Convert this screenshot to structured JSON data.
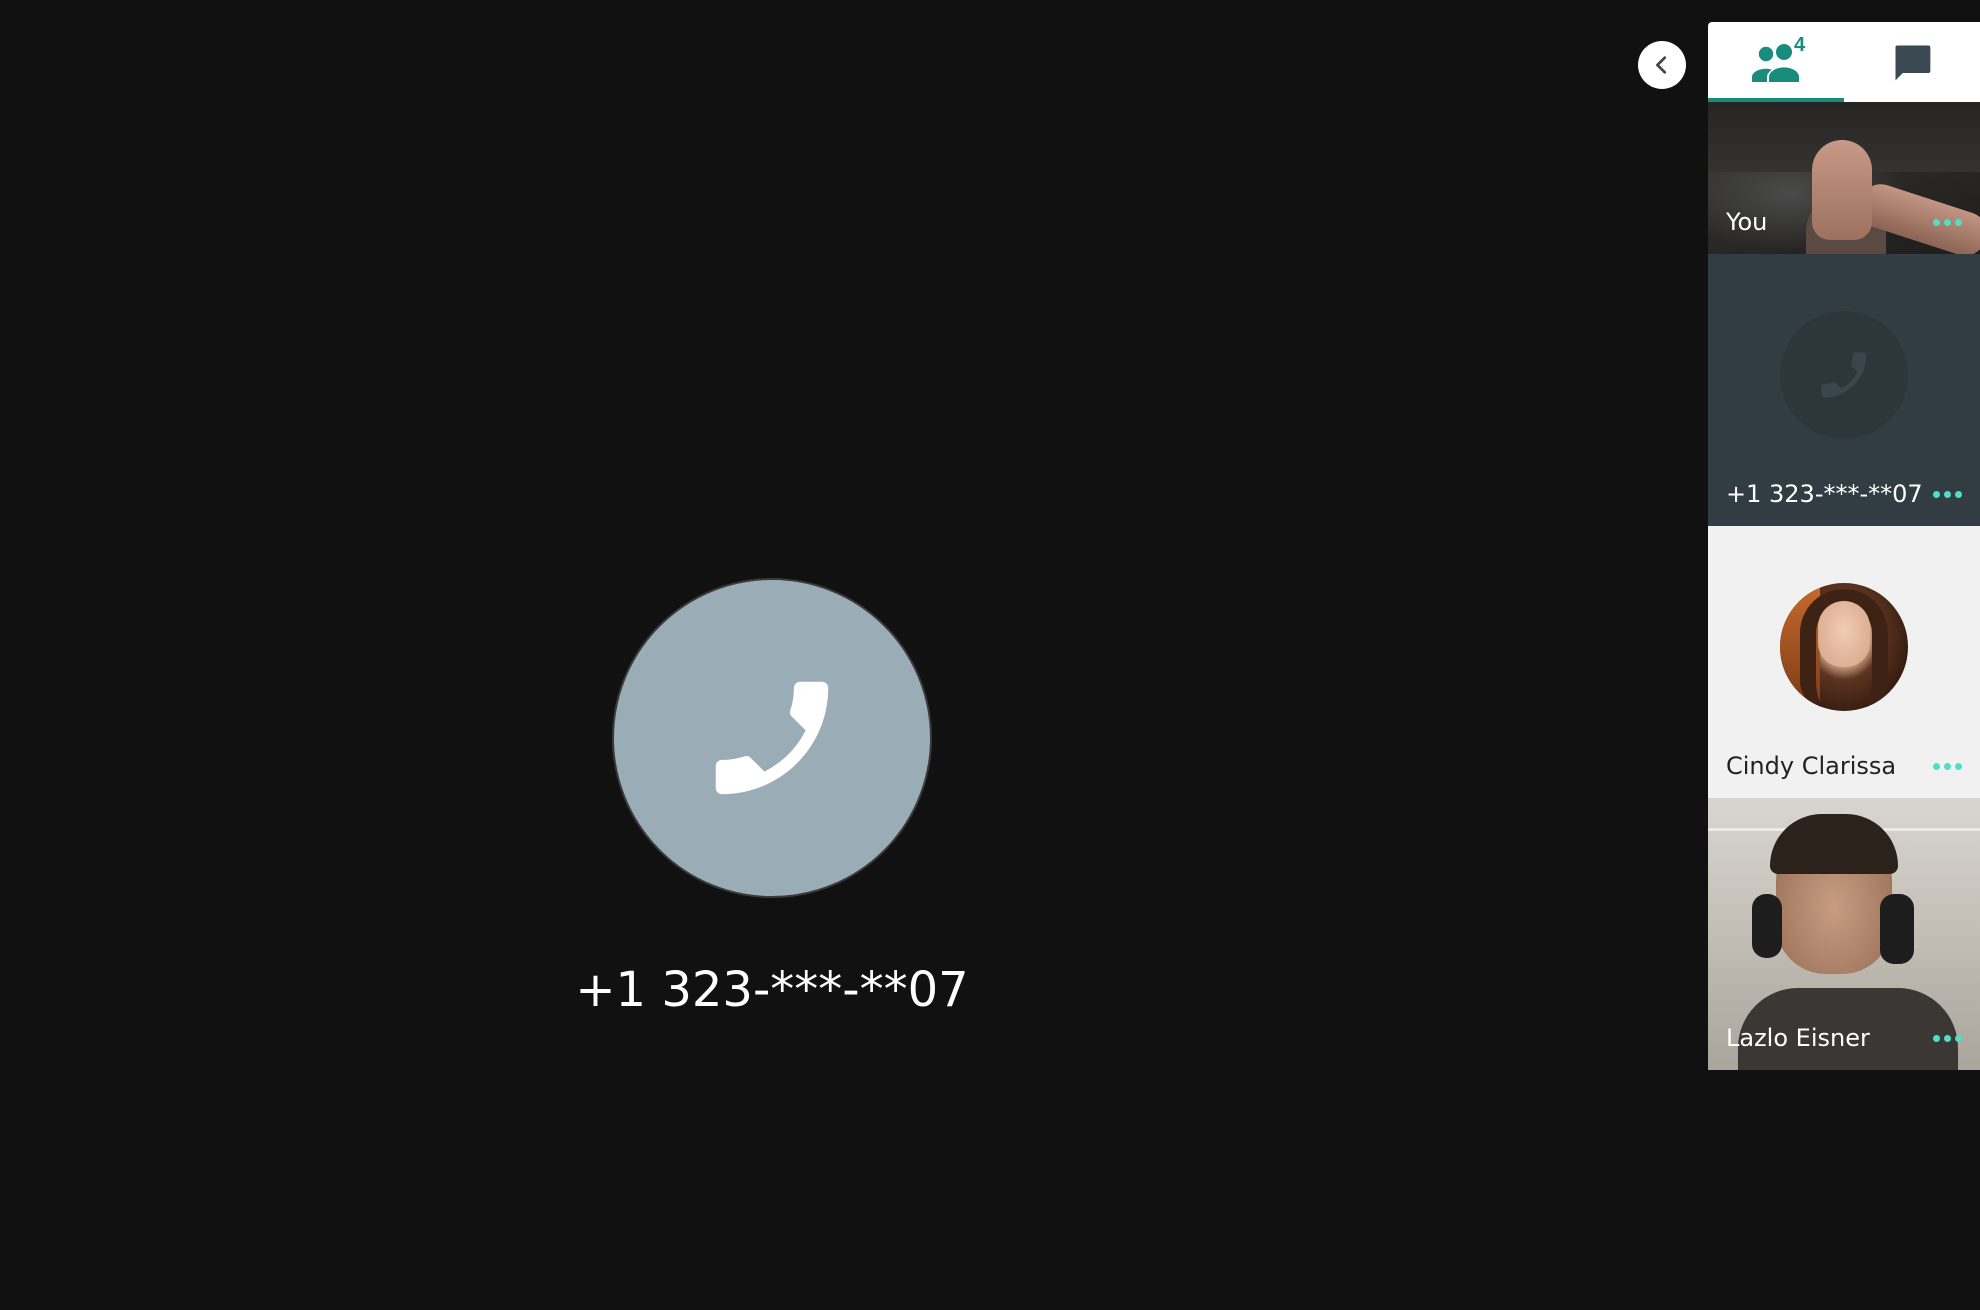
{
  "main": {
    "participant_name": "+1 323-***-**07",
    "avatar_icon": "phone-icon"
  },
  "panel": {
    "collapse_icon": "chevron-left-icon",
    "tabs": [
      {
        "name": "participants",
        "icon": "people-icon",
        "count": "4",
        "active": true
      },
      {
        "name": "chat",
        "icon": "chat-icon",
        "active": false
      }
    ],
    "participants": [
      {
        "name": "You",
        "type": "video",
        "more_icon": "more-horizontal-icon"
      },
      {
        "name": "+1 323-***-**07",
        "type": "phone",
        "more_icon": "more-horizontal-icon"
      },
      {
        "name": "Cindy Clarissa",
        "type": "avatar",
        "more_icon": "more-horizontal-icon"
      },
      {
        "name": "Lazlo Eisner",
        "type": "video",
        "more_icon": "more-horizontal-icon"
      }
    ]
  },
  "colors": {
    "background": "#111111",
    "accent": "#1a8c7e",
    "more_dots": "#4ee0c4",
    "main_avatar": "#9aacb5",
    "phone_tile": "#323d43"
  }
}
